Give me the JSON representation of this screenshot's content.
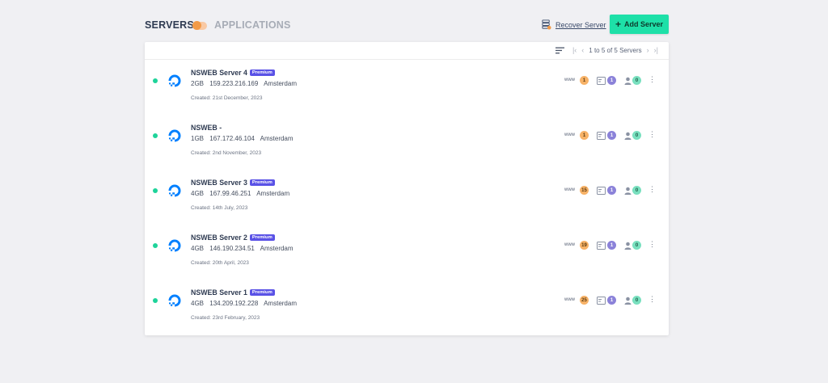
{
  "header": {
    "servers_tab": "SERVERS",
    "applications_tab": "APPLICATIONS",
    "recover_label": "Recover Server",
    "add_label": "Add Server"
  },
  "toolbar": {
    "pagination_text": "1 to 5 of 5 Servers"
  },
  "servers": [
    {
      "name": "NSWEB Server 4",
      "badge": "Premium",
      "ram": "2GB",
      "ip": "159.223.216.169",
      "location": "Amsterdam",
      "created": "Created: 21st December, 2023",
      "www": "1",
      "db": "1",
      "users": "0"
    },
    {
      "name": "NSWEB - ",
      "badge": "",
      "ram": "1GB",
      "ip": "167.172.46.104",
      "location": "Amsterdam",
      "created": "Created: 2nd November, 2023",
      "www": "1",
      "db": "1",
      "users": "0"
    },
    {
      "name": "NSWEB Server 3",
      "badge": "Premium",
      "ram": "4GB",
      "ip": "167.99.46.251",
      "location": "Amsterdam",
      "created": "Created: 14th July, 2023",
      "www": "15",
      "db": "1",
      "users": "0"
    },
    {
      "name": "NSWEB Server 2",
      "badge": "Premium",
      "ram": "4GB",
      "ip": "146.190.234.51",
      "location": "Amsterdam",
      "created": "Created: 20th April, 2023",
      "www": "19",
      "db": "1",
      "users": "0"
    },
    {
      "name": "NSWEB Server 1",
      "badge": "Premium",
      "ram": "4GB",
      "ip": "134.209.192.228",
      "location": "Amsterdam",
      "created": "Created: 23rd February, 2023",
      "www": "25",
      "db": "1",
      "users": "0"
    }
  ],
  "stats_labels": {
    "www": "www"
  },
  "colors": {
    "accent": "#1ee0a8",
    "premium": "#5a52e6",
    "online": "#1ed39a",
    "brand_blue": "#0080ff"
  },
  "icons": [
    "sort-icon",
    "first-page-icon",
    "prev-page-icon",
    "next-page-icon",
    "last-page-icon",
    "recover-server-icon",
    "plus-icon",
    "digitalocean-logo-icon",
    "database-icon",
    "user-icon",
    "kebab-menu-icon"
  ]
}
